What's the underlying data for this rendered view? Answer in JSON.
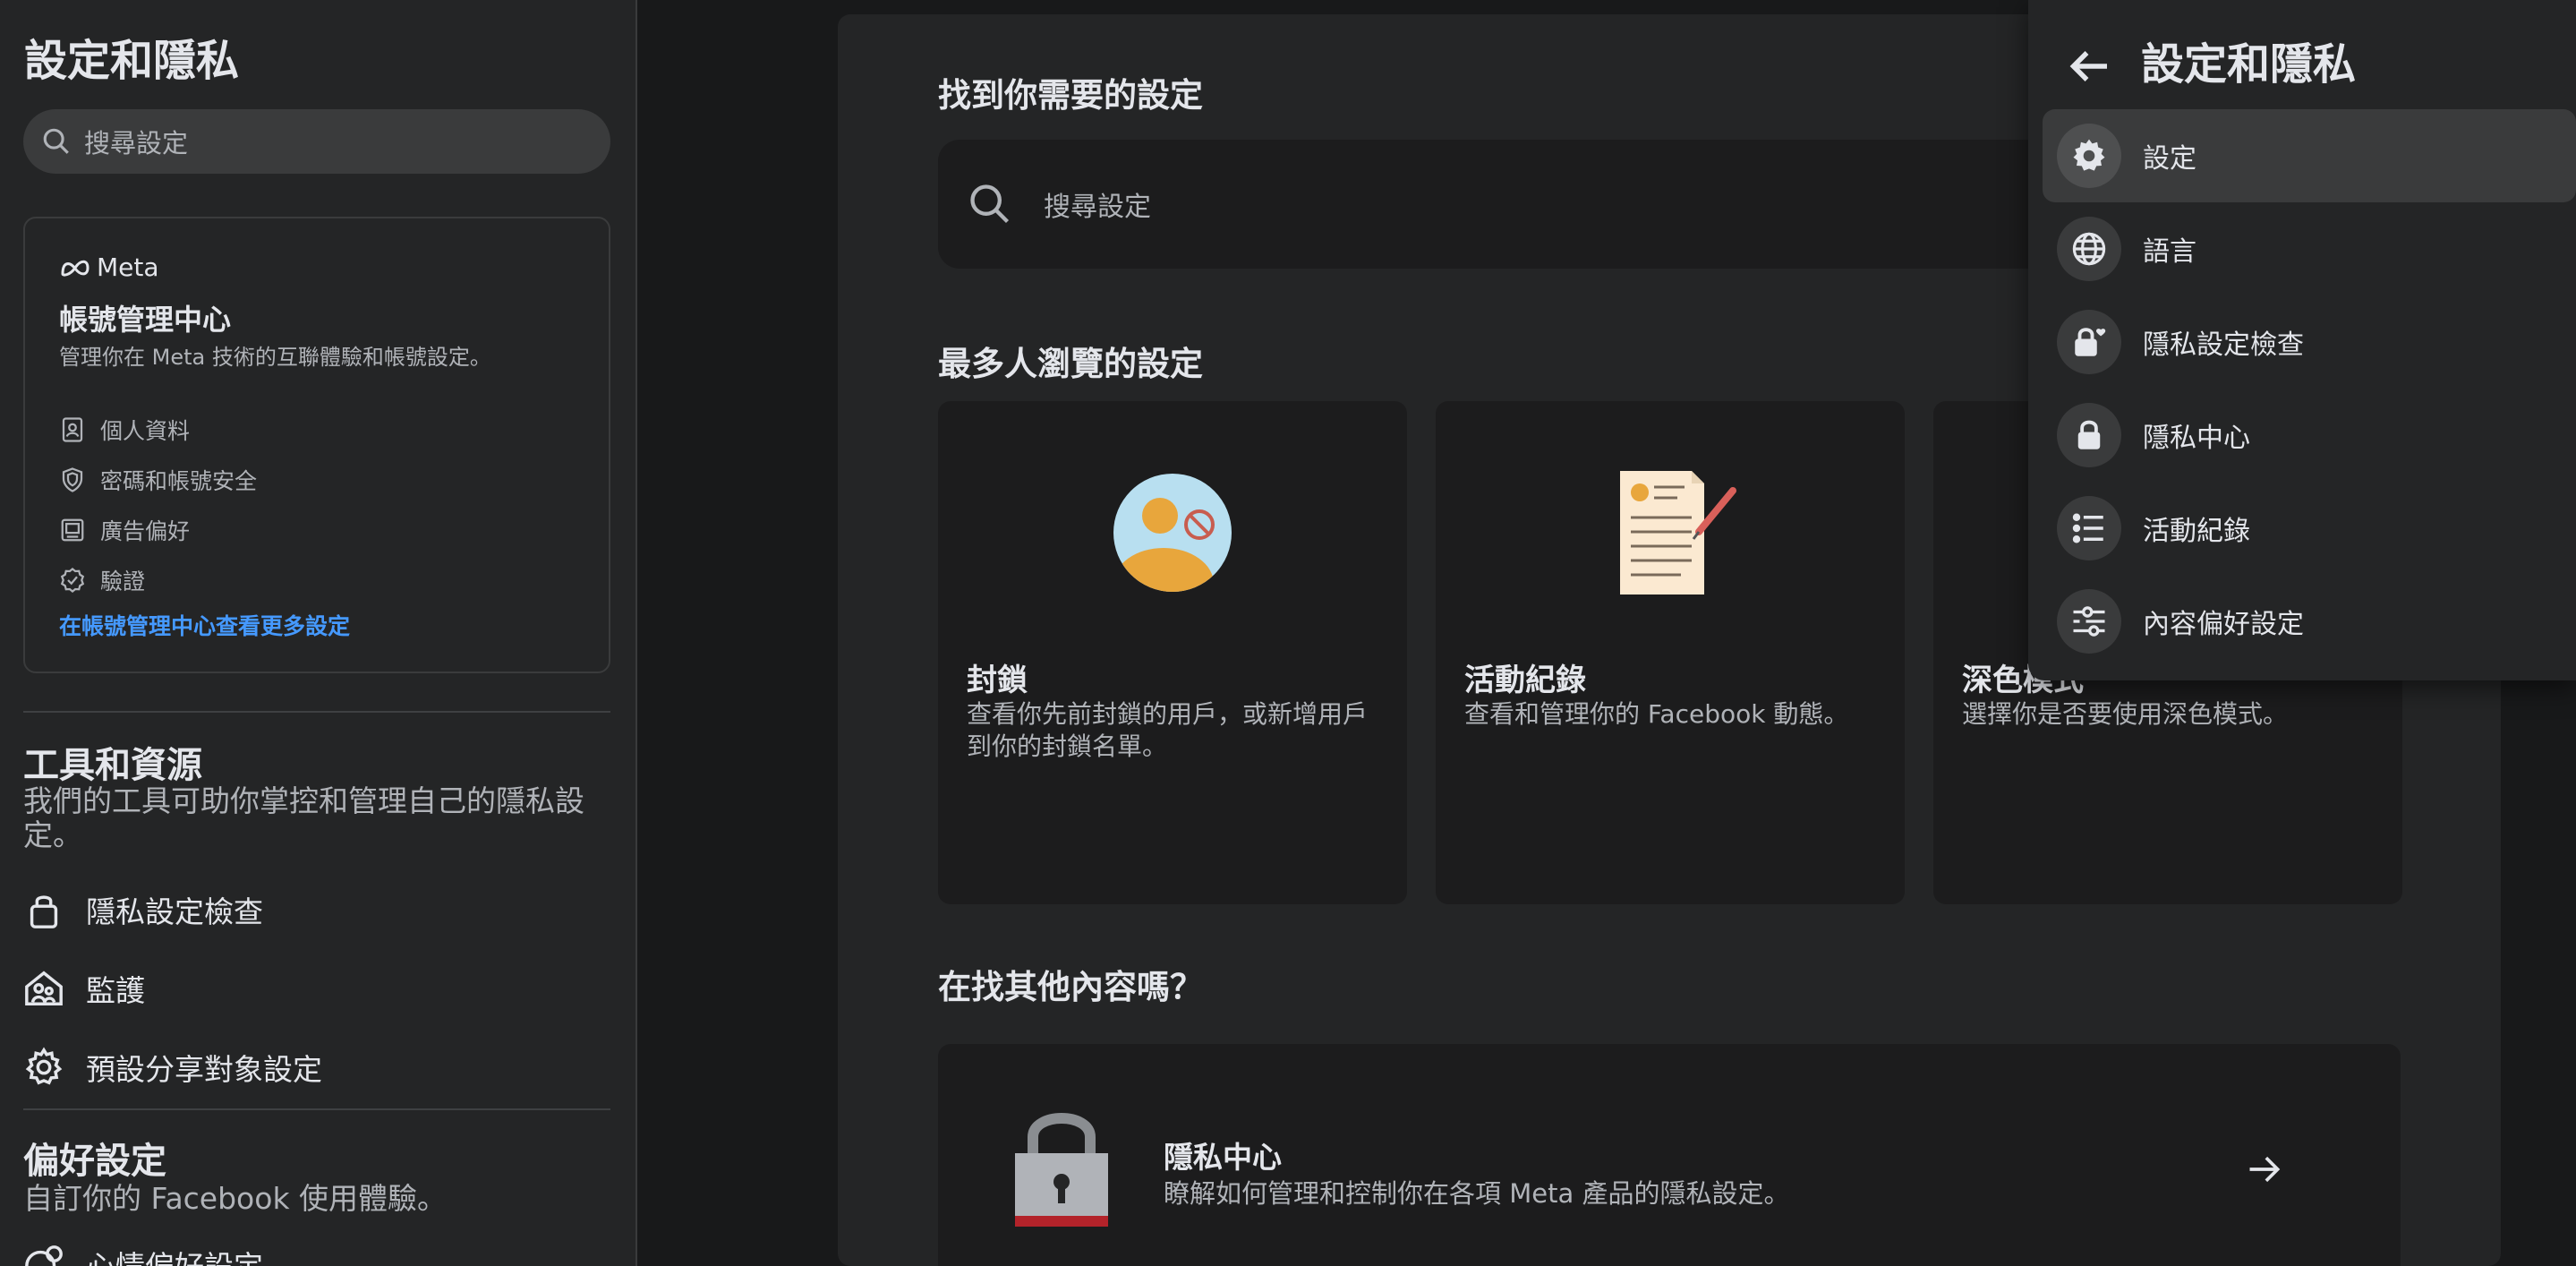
{
  "sidebar": {
    "title": "設定和隱私",
    "search_placeholder": "搜尋設定",
    "meta_card": {
      "logo_text": "Meta",
      "title": "帳號管理中心",
      "description": "管理你在 Meta 技術的互聯體驗和帳號設定。",
      "items": [
        "個人資料",
        "密碼和帳號安全",
        "廣告偏好",
        "驗證"
      ],
      "link": "在帳號管理中心查看更多設定"
    },
    "tools_section": {
      "title": "工具和資源",
      "description": "我們的工具可助你掌控和管理自己的隱私設定。",
      "items": [
        "隱私設定檢查",
        "監護",
        "預設分享對象設定"
      ]
    },
    "prefs_section": {
      "title": "偏好設定",
      "description": "自訂你的 Facebook 使用體驗。",
      "partial_item": "心情偏好設定"
    }
  },
  "main": {
    "find_heading": "找到你需要的設定",
    "search_placeholder": "搜尋設定",
    "popular_heading": "最多人瀏覽的設定",
    "cards": [
      {
        "title": "封鎖",
        "description": "查看你先前封鎖的用戶，或新增用戶到你的封鎖名單。"
      },
      {
        "title": "活動紀錄",
        "description": "查看和管理你的 Facebook 動態。"
      },
      {
        "title": "深色模式",
        "description": "選擇你是否要使用深色模式。"
      }
    ],
    "other_heading": "在找其他內容嗎？",
    "privacy_center": {
      "title": "隱私中心",
      "description": "瞭解如何管理和控制你在各項 Meta 產品的隱私設定。"
    }
  },
  "dropdown": {
    "title": "設定和隱私",
    "items": [
      {
        "label": "設定",
        "icon": "gear-icon"
      },
      {
        "label": "語言",
        "icon": "globe-icon"
      },
      {
        "label": "隱私設定檢查",
        "icon": "lock-heart-icon"
      },
      {
        "label": "隱私中心",
        "icon": "lock-icon"
      },
      {
        "label": "活動紀錄",
        "icon": "list-icon"
      },
      {
        "label": "內容偏好設定",
        "icon": "sliders-icon"
      }
    ]
  },
  "colors": {
    "background": "#18191a",
    "panel": "#242526",
    "link": "#4599ff"
  }
}
